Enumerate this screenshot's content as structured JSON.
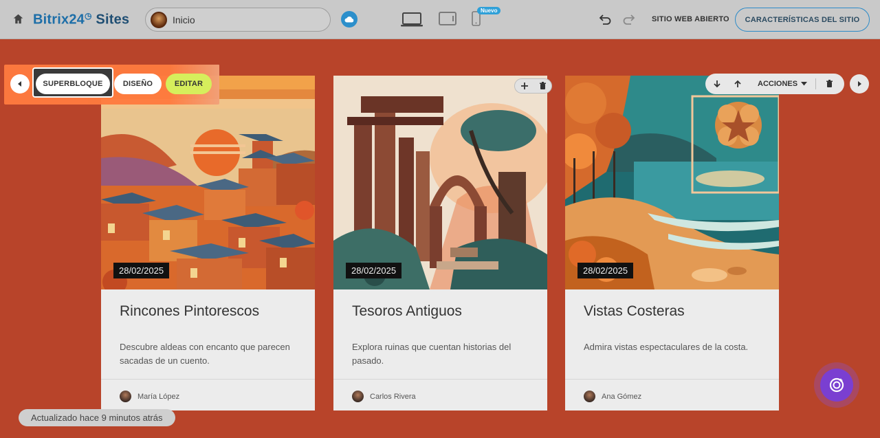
{
  "header": {
    "logo_brand": "Bitrix24",
    "logo_product": "Sites",
    "page_name": "Inicio",
    "new_badge": "Nuevo",
    "open_site_label": "SITIO WEB ABIERTO",
    "features_label": "CARACTERÍSTICAS DEL SITIO"
  },
  "block_toolbar": {
    "superblock_label": "SUPERBLOQUE",
    "design_label": "DISEÑO",
    "edit_label": "EDITAR",
    "actions_label": "ACCIONES"
  },
  "cards": [
    {
      "date": "28/02/2025",
      "title": "Rincones Pintorescos",
      "description": "Descubre aldeas con encanto que parecen sacadas de un cuento.",
      "author": "María López"
    },
    {
      "date": "28/02/2025",
      "title": "Tesoros Antiguos",
      "description": "Explora ruinas que cuentan historias del pasado.",
      "author": "Carlos Rivera"
    },
    {
      "date": "28/02/2025",
      "title": "Vistas Costeras",
      "description": "Admira vistas espectaculares de la costa.",
      "author": "Ana Gómez"
    }
  ],
  "status_text": "Actualizado hace 9 minutos atrás",
  "colors": {
    "page_bg": "#b8442a",
    "accent_blue": "#2b8ac8",
    "edit_green": "#d6ee5c",
    "toolbar_orange": "#ff7b3f",
    "assistant_purple": "#7a3fd1"
  },
  "icons": [
    "home-icon",
    "cloud-icon",
    "desktop-icon",
    "tablet-icon",
    "mobile-icon",
    "undo-icon",
    "redo-icon",
    "arrow-left-icon",
    "arrow-right-icon",
    "arrow-down-icon",
    "arrow-up-icon",
    "trash-icon",
    "plus-icon",
    "assistant-icon"
  ]
}
